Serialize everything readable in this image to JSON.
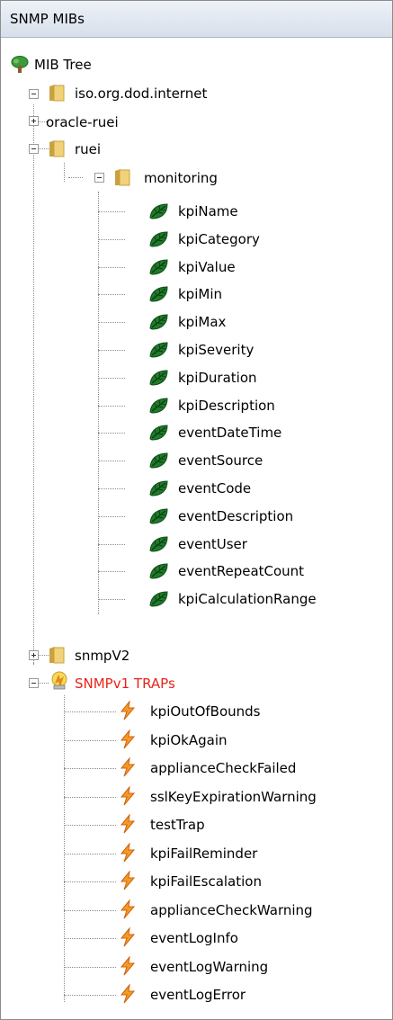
{
  "panel": {
    "title": "SNMP MIBs"
  },
  "tree": {
    "root": "MIB Tree",
    "internet": "iso.org.dod.internet",
    "oracle_ruei": "oracle-ruei",
    "ruei": "ruei",
    "monitoring": "monitoring",
    "leaves": [
      "kpiName",
      "kpiCategory",
      "kpiValue",
      "kpiMin",
      "kpiMax",
      "kpiSeverity",
      "kpiDuration",
      "kpiDescription",
      "eventDateTime",
      "eventSource",
      "eventCode",
      "eventDescription",
      "eventUser",
      "eventRepeatCount",
      "kpiCalculationRange"
    ],
    "snmpv2": "snmpV2",
    "traps_folder": "SNMPv1 TRAPs",
    "traps": [
      "kpiOutOfBounds",
      "kpiOkAgain",
      "applianceCheckFailed",
      "sslKeyExpirationWarning",
      "testTrap",
      "kpiFailReminder",
      "kpiFailEscalation",
      "applianceCheckWarning",
      "eventLogInfo",
      "eventLogWarning",
      "eventLogError"
    ]
  },
  "colors": {
    "traps_label": "#e8241a",
    "leaf_icon": "#1f7a2a",
    "trap_icon": "#f07a1a",
    "folder": "#e0b84a"
  },
  "icons": {
    "root": "tree-icon",
    "folder": "folder-icon",
    "leaf": "leaf-icon",
    "traps_folder": "trap-group-icon",
    "trap": "lightning-icon"
  }
}
